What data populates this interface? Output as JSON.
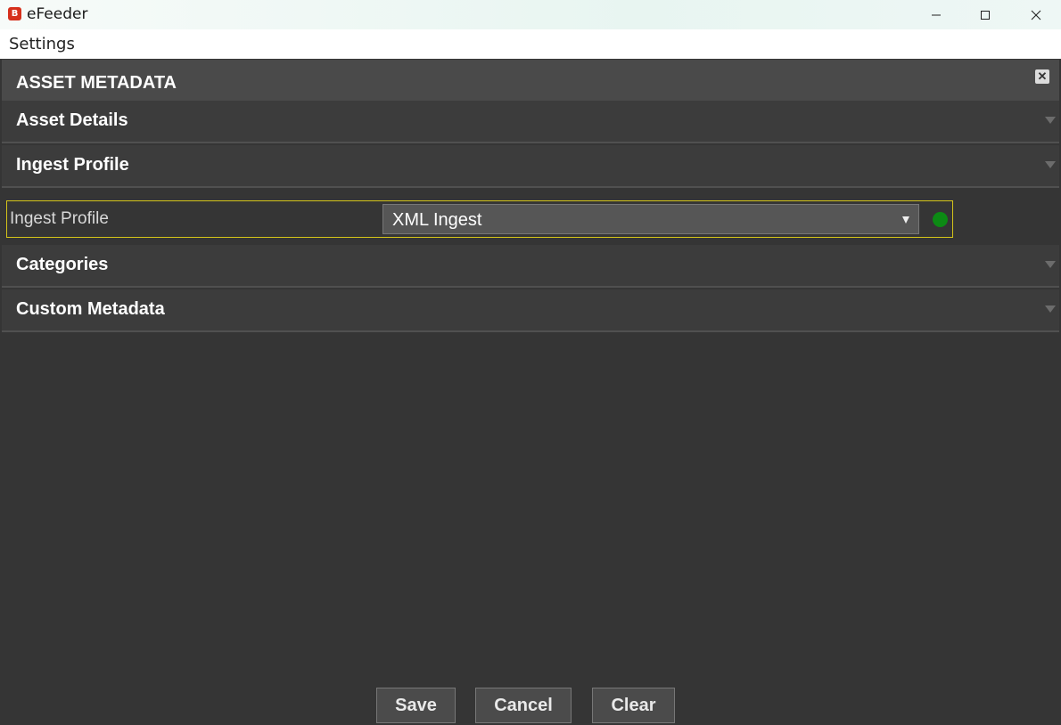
{
  "window": {
    "title": "eFeeder",
    "icon": "app-logo-icon",
    "icon_letter": "B",
    "icon_color": "#d6301c"
  },
  "menu": {
    "items": [
      {
        "label": "Settings"
      }
    ]
  },
  "panel": {
    "title": "ASSET METADATA",
    "close_glyph": "✕"
  },
  "sections": [
    {
      "label": "Asset Details"
    },
    {
      "label": "Ingest Profile"
    },
    {
      "label": "Categories"
    },
    {
      "label": "Custom Metadata"
    }
  ],
  "ingest_profile": {
    "label": "Ingest Profile",
    "selected": "XML Ingest",
    "status_color": "#0c8a14",
    "highlight_color": "#d4c41a"
  },
  "buttons": {
    "save": "Save",
    "cancel": "Cancel",
    "clear": "Clear"
  }
}
